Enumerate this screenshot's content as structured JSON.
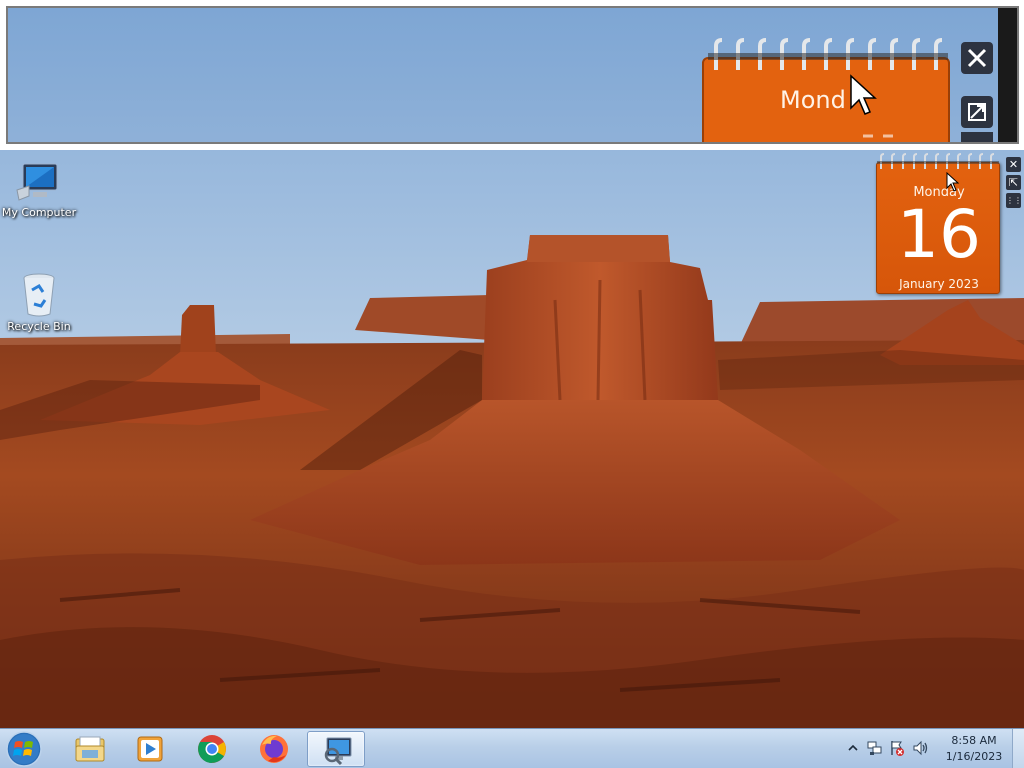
{
  "desktop": {
    "icons": [
      {
        "label": "My Computer"
      },
      {
        "label": "Recycle Bin"
      }
    ]
  },
  "gadget": {
    "day_name": "Monday",
    "date": "16",
    "month_year": "January 2023"
  },
  "magnifier": {
    "visible_day_text": "Mond"
  },
  "taskbar": {
    "apps": [
      "windows-explorer",
      "windows-media-player",
      "google-chrome",
      "mozilla-firefox",
      "display-settings"
    ],
    "active_app": "display-settings"
  },
  "tray": {
    "time": "8:58 AM",
    "date": "1/16/2023"
  },
  "colors": {
    "gadget_orange": "#e3620f",
    "taskbar": "#b9cfe8",
    "sky": "#8fb2d9"
  }
}
